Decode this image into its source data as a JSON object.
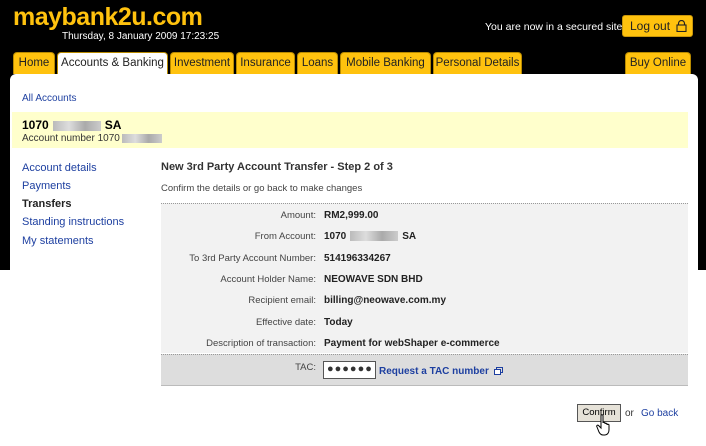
{
  "header": {
    "logo": "maybank2u.com",
    "datetime": "Thursday, 8 January 2009 17:23:25",
    "secure_text": "You are now in a secured site",
    "logout_label": "Log out"
  },
  "tabs": [
    {
      "label": "Home"
    },
    {
      "label": "Accounts & Banking"
    },
    {
      "label": "Investment"
    },
    {
      "label": "Insurance"
    },
    {
      "label": "Loans"
    },
    {
      "label": "Mobile Banking"
    },
    {
      "label": "Personal Details"
    },
    {
      "label": "Buy Online"
    }
  ],
  "breadcrumb": "All Accounts",
  "account": {
    "number_prefix": "1070",
    "type": "SA",
    "sub_label": "Account number 1070"
  },
  "sidebar": {
    "items": [
      {
        "label": "Account details"
      },
      {
        "label": "Payments"
      },
      {
        "label": "Transfers"
      },
      {
        "label": "Standing instructions"
      },
      {
        "label": "My statements"
      }
    ]
  },
  "step": {
    "title": "New 3rd Party Account Transfer - Step 2 of 3",
    "subtitle": "Confirm the details or go back to make changes"
  },
  "details": [
    {
      "label": "Amount:",
      "value": "RM2,999.00"
    },
    {
      "label": "From Account:",
      "value": "1070",
      "value_suffix": "SA"
    },
    {
      "label": "To 3rd Party Account Number:",
      "value": "514196334267"
    },
    {
      "label": "Account Holder Name:",
      "value": "NEOWAVE SDN BHD"
    },
    {
      "label": "Recipient email:",
      "value": "billing@neowave.com.my"
    },
    {
      "label": "Effective date:",
      "value": "Today"
    },
    {
      "label": "Description of transaction:",
      "value": "Payment for webShaper e-commerce"
    }
  ],
  "tac": {
    "label": "TAC:",
    "value": "●●●●●●",
    "request_link": "Request a TAC number"
  },
  "actions": {
    "confirm_label": "Confirm",
    "or_text": "or",
    "goback_label": "Go back"
  },
  "colors": {
    "brand_yellow": "#ffc20e",
    "link_blue": "#1d3fa0",
    "account_highlight": "#ffffcc"
  }
}
